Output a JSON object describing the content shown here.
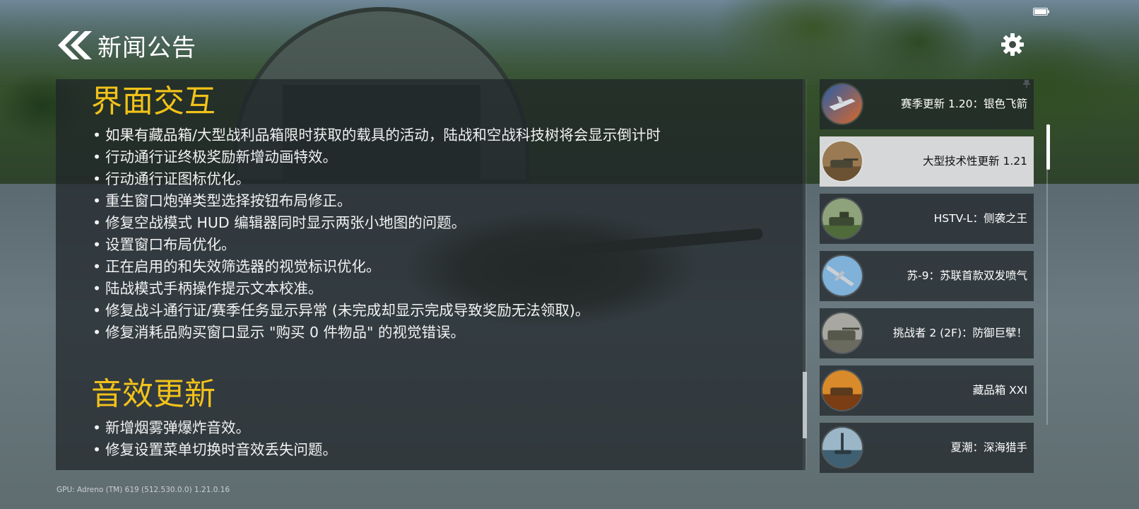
{
  "header": {
    "title": "新闻公告"
  },
  "article": {
    "sections": [
      {
        "heading": "界面交互",
        "bullets": [
          "如果有藏品箱/大型战利品箱限时获取的载具的活动，陆战和空战科技树将会显示倒计时",
          "行动通行证终极奖励新增动画特效。",
          "行动通行证图标优化。",
          "重生窗口炮弹类型选择按钮布局修正。",
          "修复空战模式 HUD 编辑器同时显示两张小地图的问题。",
          "设置窗口布局优化。",
          "正在启用的和失效筛选器的视觉标识优化。",
          "陆战模式手柄操作提示文本校准。",
          "修复战斗通行证/赛季任务显示异常 (未完成却显示完成导致奖励无法领取)。",
          "修复消耗品购买窗口显示 \"购买 0 件物品\" 的视觉错误。"
        ]
      },
      {
        "heading": "音效更新",
        "bullets": [
          "新增烟雾弹爆炸音效。",
          "修复设置菜单切换时音效丢失问题。"
        ]
      }
    ]
  },
  "news_list": {
    "items": [
      {
        "label": "赛季更新 1.20：银色飞箭",
        "thumb": "jet-aircraft",
        "selected": false
      },
      {
        "label": "大型技术性更新 1.21",
        "thumb": "tank-desert",
        "selected": true
      },
      {
        "label": "HSTV-L：侧袭之王",
        "thumb": "tank-green",
        "selected": false
      },
      {
        "label": "苏-9：苏联首款双发喷气",
        "thumb": "jet-sky",
        "selected": false
      },
      {
        "label": "挑战者 2 (2F)：防御巨擘！",
        "thumb": "tank-camo",
        "selected": false
      },
      {
        "label": "藏品箱 XXI",
        "thumb": "tank-fire",
        "selected": false
      },
      {
        "label": "夏潮：深海猎手",
        "thumb": "submarine",
        "selected": false
      }
    ]
  },
  "footer": {
    "gpu_info": "GPU: Adreno (TM) 619 (512.530.0.0)  1.21.0.16"
  },
  "colors": {
    "heading": "#f2c21a",
    "panel": "rgba(30,36,40,0.72)",
    "selected": "#d6d7d8"
  }
}
